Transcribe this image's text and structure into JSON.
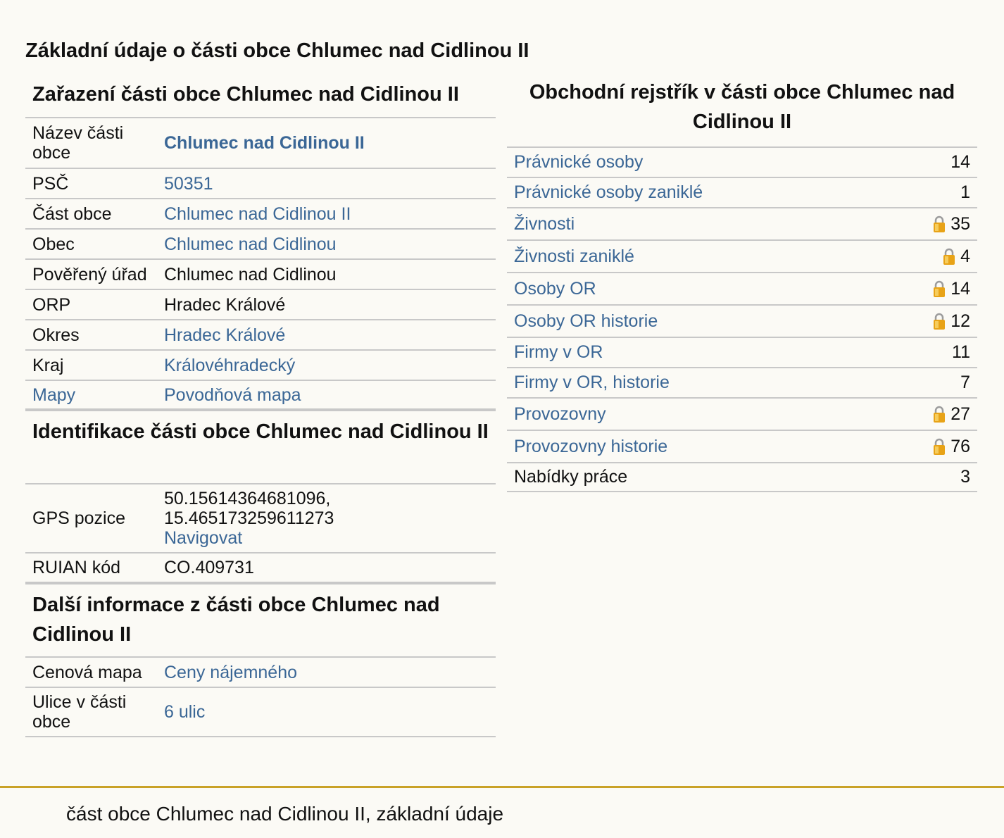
{
  "page_title": "Základní údaje o části obce Chlumec nad Cidlinou II",
  "zarazeni": {
    "title": "Zařazení části obce Chlumec nad Cidlinou II",
    "rows": [
      {
        "key": "Název části obce",
        "value": "Chlumec nad Cidlinou II"
      },
      {
        "key": "PSČ",
        "value": "50351"
      },
      {
        "key": "Část obce",
        "value": "Chlumec nad Cidlinou II"
      },
      {
        "key": "Obec",
        "value": "Chlumec nad Cidlinou"
      },
      {
        "key": "Pověřený úřad",
        "value": "Chlumec nad Cidlinou"
      },
      {
        "key": "ORP",
        "value": "Hradec Králové"
      },
      {
        "key": "Okres",
        "value": "Hradec Králové"
      },
      {
        "key": "Kraj",
        "value": "Královéhradecký"
      },
      {
        "key": "Mapy",
        "value": "Povodňová mapa"
      }
    ]
  },
  "identifikace": {
    "title": "Identifikace části obce Chlumec nad Cidlinou II",
    "gps_label": "GPS pozice",
    "gps_lat": "50.15614364681096,",
    "gps_lon": "15.465173259611273",
    "navigate_label": "Navigovat",
    "ruian_label": "RUIAN kód",
    "ruian_value": "CO.409731"
  },
  "dalsi": {
    "title": "Další informace z části obce Chlumec nad Cidlinou II",
    "rows": [
      {
        "key": "Cenová mapa",
        "value": "Ceny nájemného"
      },
      {
        "key": "Ulice v části obce",
        "value": "6 ulic"
      }
    ]
  },
  "rejstrik": {
    "title": "Obchodní rejstřík v části obce Chlumec nad Cidlinou II",
    "rows": [
      {
        "name": "Právnické osoby",
        "count": "14"
      },
      {
        "name": "Právnické osoby zaniklé",
        "count": "1"
      },
      {
        "name": "Živnosti",
        "count": "35"
      },
      {
        "name": "Živnosti zaniklé",
        "count": "4"
      },
      {
        "name": "Osoby OR",
        "count": "14"
      },
      {
        "name": "Osoby OR historie",
        "count": "12"
      },
      {
        "name": "Firmy v OR",
        "count": "11"
      },
      {
        "name": "Firmy v OR, historie",
        "count": "7"
      },
      {
        "name": "Provozovny",
        "count": "27"
      },
      {
        "name": "Provozovny historie",
        "count": "76"
      },
      {
        "name": "Nabídky práce",
        "count": "3"
      }
    ]
  },
  "footer_text": "část obce Chlumec nad Cidlinou II, základní údaje",
  "colors": {
    "link": "#3b6796",
    "background": "#fbfaf5",
    "footer_line": "#c9a227",
    "lock": "#e8a317"
  }
}
